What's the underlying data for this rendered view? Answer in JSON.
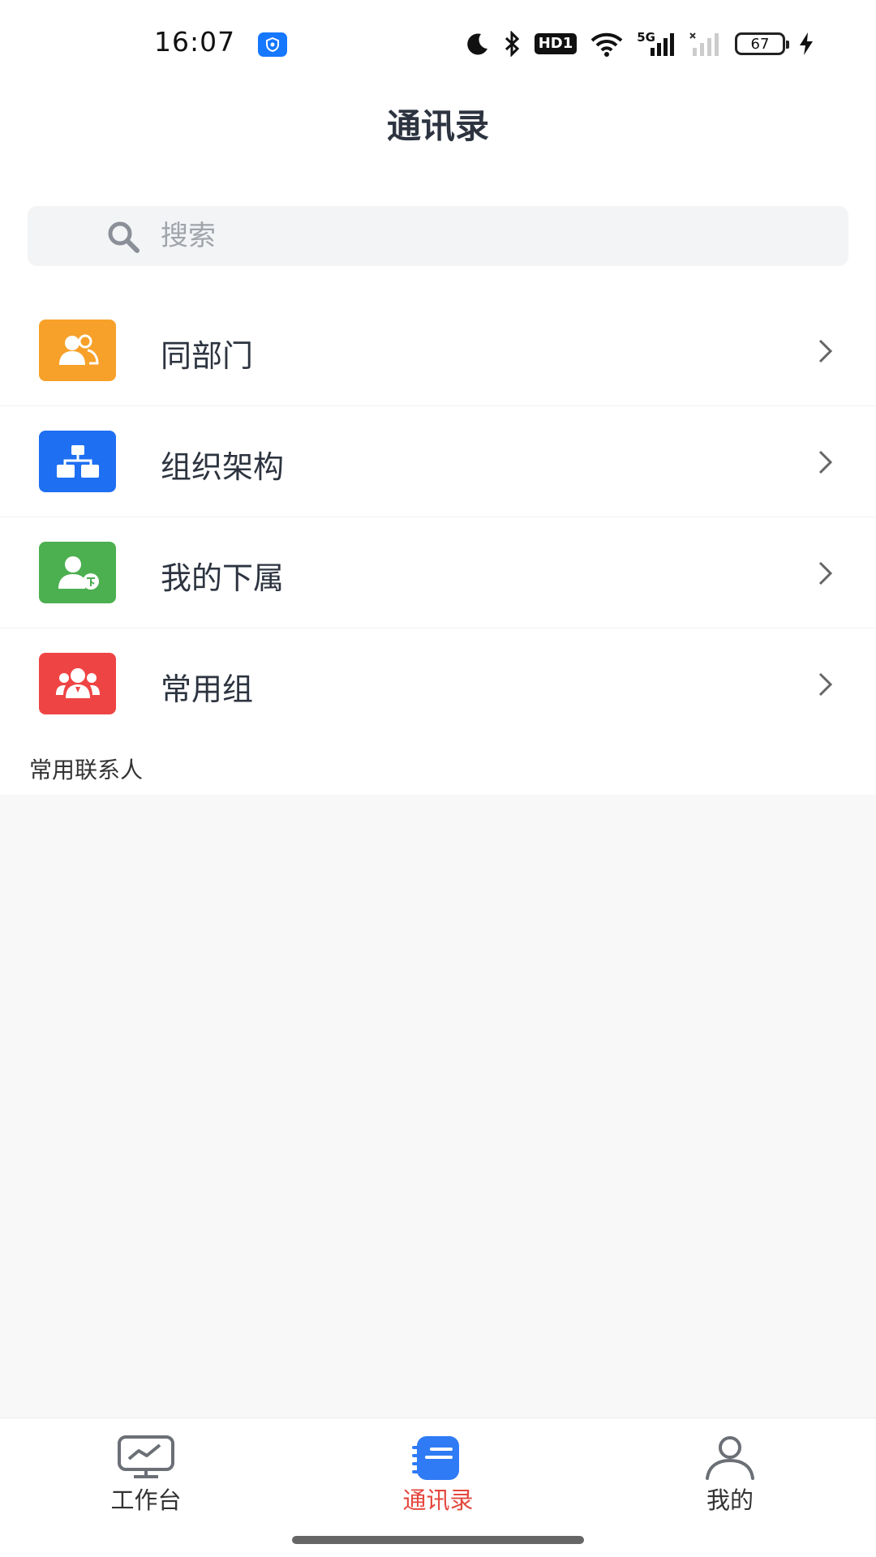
{
  "status_bar": {
    "time": "16:07",
    "network": "5G",
    "hd_label": "HD1",
    "battery": "67",
    "icons": [
      "vpn-shield-icon",
      "moon-icon",
      "bluetooth-icon",
      "hd-icon",
      "wifi-icon",
      "signal-5g-icon",
      "signal-empty-icon",
      "battery-icon",
      "charging-icon"
    ]
  },
  "header": {
    "title": "通讯录"
  },
  "search": {
    "placeholder": "搜索"
  },
  "menu": {
    "items": [
      {
        "label": "同部门",
        "icon": "same-department-icon",
        "color": "#f7a12a"
      },
      {
        "label": "组织架构",
        "icon": "org-structure-icon",
        "color": "#1e6ff2"
      },
      {
        "label": "我的下属",
        "icon": "subordinates-icon",
        "color": "#4caf50"
      },
      {
        "label": "常用组",
        "icon": "frequent-group-icon",
        "color": "#ef4444"
      }
    ]
  },
  "section": {
    "title": "常用联系人"
  },
  "tabbar": {
    "tabs": [
      {
        "label": "工作台",
        "icon": "workbench-icon",
        "active": false
      },
      {
        "label": "通讯录",
        "icon": "contacts-icon",
        "active": true
      },
      {
        "label": "我的",
        "icon": "profile-icon",
        "active": false
      }
    ],
    "active_color": "#e4473e",
    "accent_color": "#2f7bf5"
  }
}
